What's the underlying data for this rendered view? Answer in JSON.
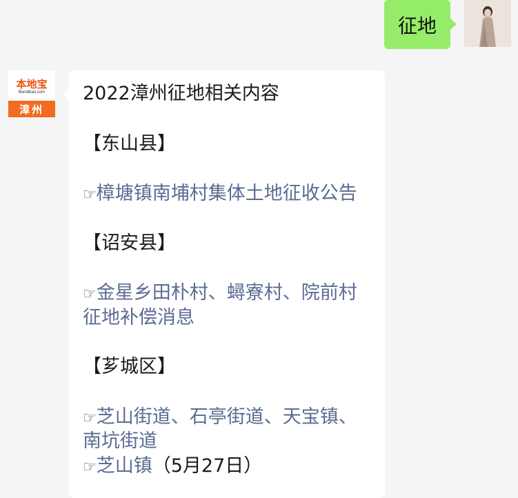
{
  "user": {
    "message": "征地"
  },
  "bot": {
    "logo": {
      "name": "本地宝",
      "url": "Bendibao.com",
      "city": "漳州"
    },
    "title": "2022漳州征地相关内容",
    "sections": [
      {
        "heading": "【东山县】",
        "links": [
          {
            "lines": [
              "樟塘镇南埔村集体土地征收公告"
            ]
          }
        ]
      },
      {
        "heading": "【诏安县】",
        "links": [
          {
            "lines": [
              "金星乡田朴村、蟳寮村、院前村",
              "征地补偿消息"
            ]
          }
        ]
      },
      {
        "heading": "【芗城区】",
        "links": [
          {
            "lines": [
              "芝山街道、石亭街道、天宝镇、",
              "南坑街道"
            ]
          },
          {
            "lines": [
              "芝山镇"
            ],
            "suffix": "（5月27日）"
          }
        ]
      }
    ],
    "pointer_glyph": "☞"
  }
}
